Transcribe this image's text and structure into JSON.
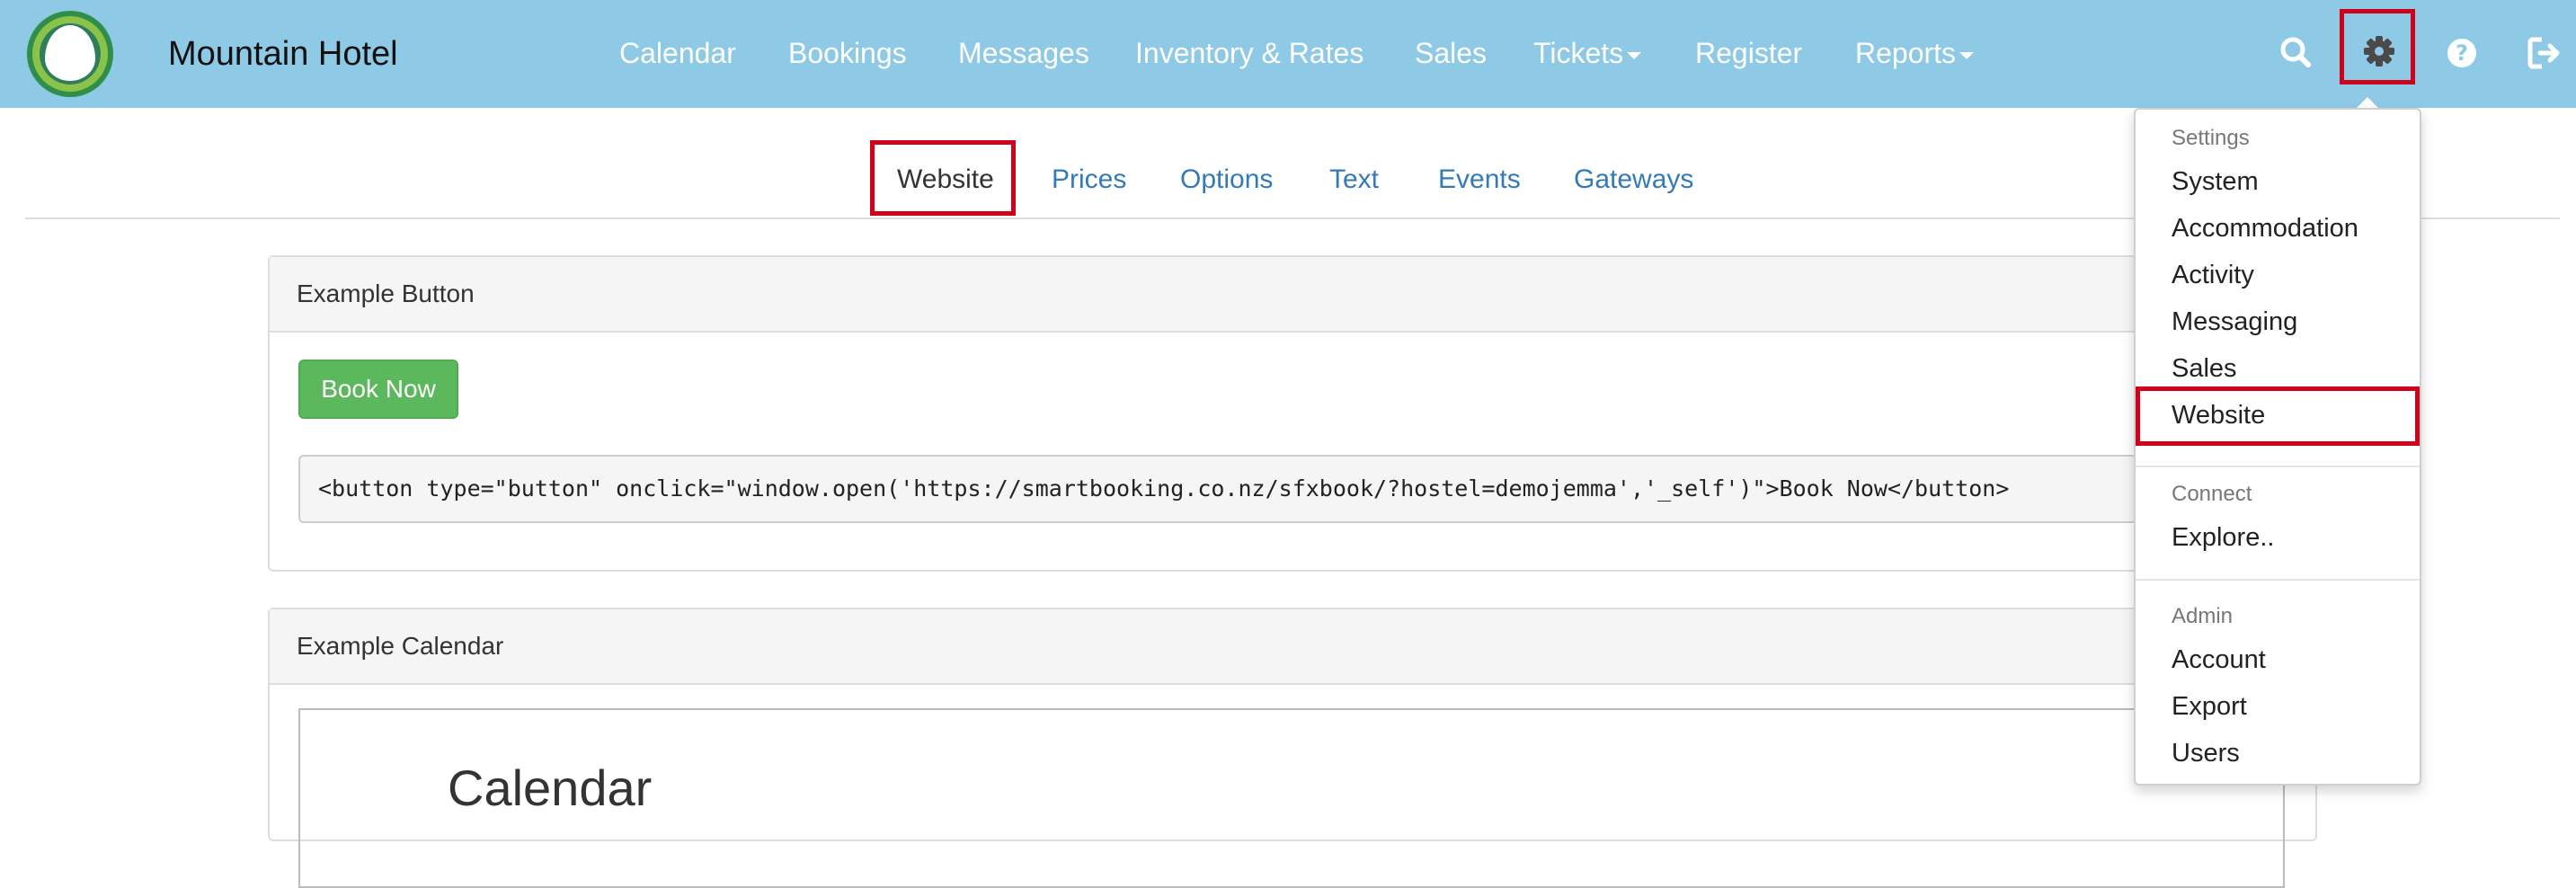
{
  "brand": {
    "name": "Mountain Hotel",
    "logo_icon": "hotel-logo-icon"
  },
  "nav": {
    "links": [
      "Calendar",
      "Bookings",
      "Messages",
      "Inventory & Rates",
      "Sales",
      "Tickets",
      "Register",
      "Reports"
    ],
    "icons": [
      "search-icon",
      "gear-icon",
      "help-icon",
      "logout-icon"
    ]
  },
  "tabs": [
    "Website",
    "Prices",
    "Options",
    "Text",
    "Events",
    "Gateways"
  ],
  "button_panel": {
    "heading": "Example Button",
    "button_label": "Book Now",
    "code": "<button type=\"button\" onclick=\"window.open('https://smartbooking.co.nz/sfxbook/?hostel=demojemma','_self')\">Book Now</button>"
  },
  "calendar_panel": {
    "heading": "Example Calendar",
    "calendar_title": "Calendar"
  },
  "dropdown": {
    "settings_header": "Settings",
    "settings_items": [
      "System",
      "Accommodation",
      "Activity",
      "Messaging",
      "Sales",
      "Website"
    ],
    "connect_header": "Connect",
    "connect_items": [
      "Explore.."
    ],
    "admin_header": "Admin",
    "admin_items": [
      "Account",
      "Export",
      "Users"
    ]
  },
  "colors": {
    "navbar": "#8ecae6",
    "link": "#337ab7",
    "success": "#5cb85c",
    "highlight": "#d0021b"
  }
}
